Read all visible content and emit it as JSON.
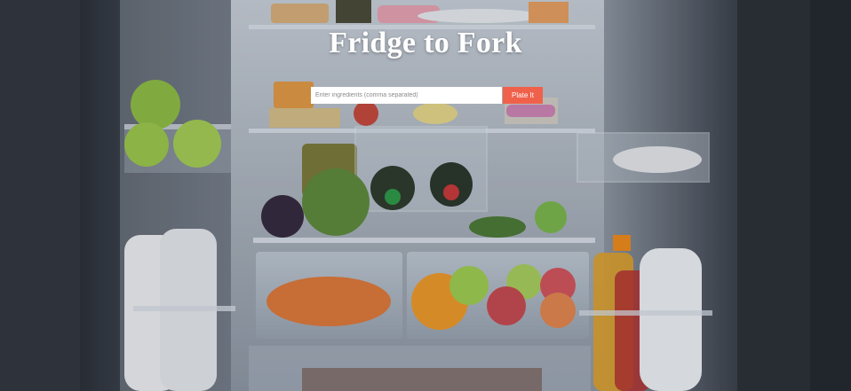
{
  "app": {
    "title": "Fridge to Fork"
  },
  "search": {
    "placeholder": "Enter ingredients (comma separated)",
    "value": "",
    "button_label": "Plate It"
  },
  "colors": {
    "button": "#f0614c",
    "title": "#ffffff",
    "input_background": "#ffffff"
  },
  "background": {
    "description_icon": "open-fridge-photo"
  }
}
